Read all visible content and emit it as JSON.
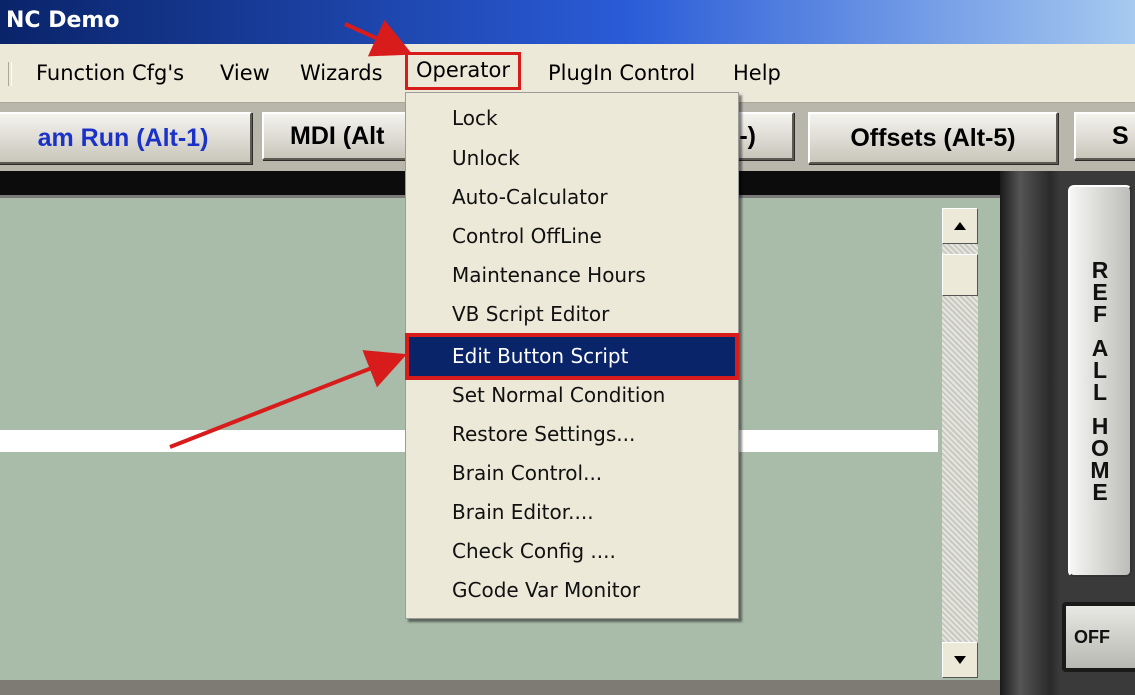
{
  "window": {
    "title": "NC Demo"
  },
  "menubar": {
    "items": [
      "Function Cfg's",
      "View",
      "Wizards",
      "Operator",
      "PlugIn Control",
      "Help"
    ],
    "active": "Operator"
  },
  "tabs": [
    {
      "label": "am Run (Alt-1)",
      "active": true
    },
    {
      "label": "MDI (Alt",
      "active": false
    },
    {
      "label": "-)",
      "active": false
    },
    {
      "label": "Offsets (Alt-5)",
      "active": false
    },
    {
      "label": "S",
      "active": false
    }
  ],
  "operator_menu": {
    "items": [
      "Lock",
      "Unlock",
      "Auto-Calculator",
      "Control OffLine",
      "Maintenance Hours",
      "VB Script Editor",
      "Edit Button Script",
      "Set Normal Condition",
      "Restore Settings...",
      "Brain Control...",
      "Brain Editor....",
      "Check Config ....",
      "GCode Var Monitor"
    ],
    "selected": "Edit Button Script"
  },
  "side": {
    "ref_all_home_letters": [
      "R",
      "E",
      "F",
      "A",
      "L",
      "L",
      "H",
      "O",
      "M",
      "E"
    ],
    "off_label": "OFF"
  },
  "colors": {
    "highlight": "#0a246a",
    "annotation": "#d81c1c",
    "active_tab_text": "#1a32c8"
  }
}
